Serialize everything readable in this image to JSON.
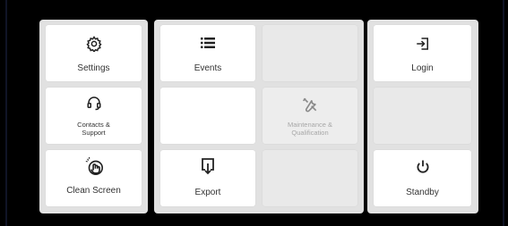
{
  "tiles": {
    "settings": {
      "label": "Settings",
      "icon": "gear-icon"
    },
    "contacts_support": {
      "label_line1": "Contacts &",
      "label_line2": "Support",
      "icon": "headset-icon"
    },
    "clean_screen": {
      "label": "Clean Screen",
      "icon": "hand-tap-icon"
    },
    "events": {
      "label": "Events",
      "icon": "list-icon"
    },
    "maintenance": {
      "label_line1": "Maintenance &",
      "label_line2": "Qualification",
      "icon": "tools-icon",
      "disabled": true
    },
    "export": {
      "label": "Export",
      "icon": "export-icon"
    },
    "login": {
      "label": "Login",
      "icon": "login-icon"
    },
    "standby": {
      "label": "Standby",
      "icon": "power-icon"
    }
  },
  "colors": {
    "panel_bg": "#e1e1e1",
    "tile_bg": "#ffffff",
    "empty_tile_bg": "#e9e9e9",
    "text": "#333333",
    "disabled_text": "#a7a7a7"
  }
}
